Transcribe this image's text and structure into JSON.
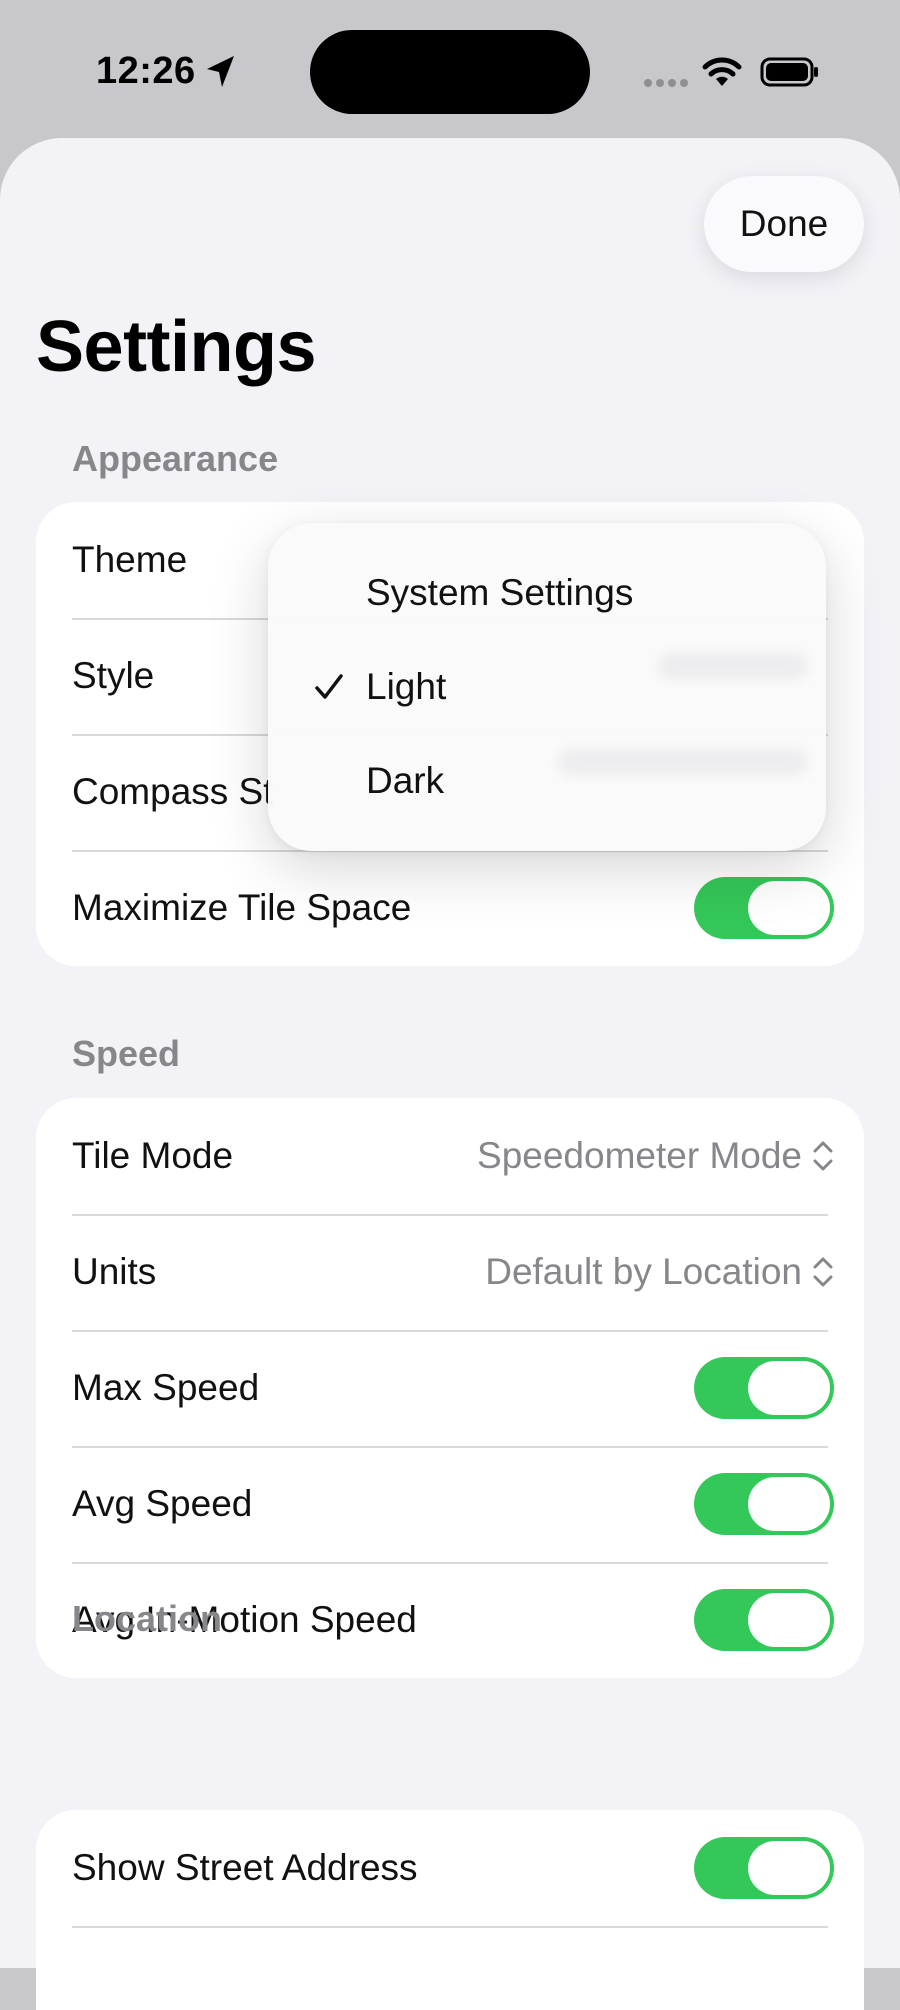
{
  "status_bar": {
    "time": "12:26"
  },
  "header": {
    "done_label": "Done",
    "title": "Settings"
  },
  "appearance": {
    "header": "Appearance",
    "rows": [
      {
        "label": "Theme"
      },
      {
        "label": "Style"
      },
      {
        "label": "Compass St"
      },
      {
        "label": "Maximize Tile Space",
        "toggle_on": true
      }
    ]
  },
  "theme_menu": {
    "items": [
      {
        "label": "System Settings",
        "checked": false
      },
      {
        "label": "Light",
        "checked": true
      },
      {
        "label": "Dark",
        "checked": false
      }
    ]
  },
  "speed": {
    "header": "Speed",
    "rows": [
      {
        "label": "Tile Mode",
        "value": "Speedometer Mode"
      },
      {
        "label": "Units",
        "value": "Default by Location"
      },
      {
        "label": "Max Speed",
        "toggle_on": true
      },
      {
        "label": "Avg Speed",
        "toggle_on": true
      },
      {
        "label": "Avg In-Motion Speed",
        "toggle_on": true
      }
    ]
  },
  "location": {
    "header": "Location",
    "rows": [
      {
        "label": "Show Street Address",
        "toggle_on": true
      }
    ]
  },
  "colors": {
    "toggle_on": "#34c759",
    "sheet_bg": "#f2f2f7",
    "secondary_text": "#86868b"
  }
}
